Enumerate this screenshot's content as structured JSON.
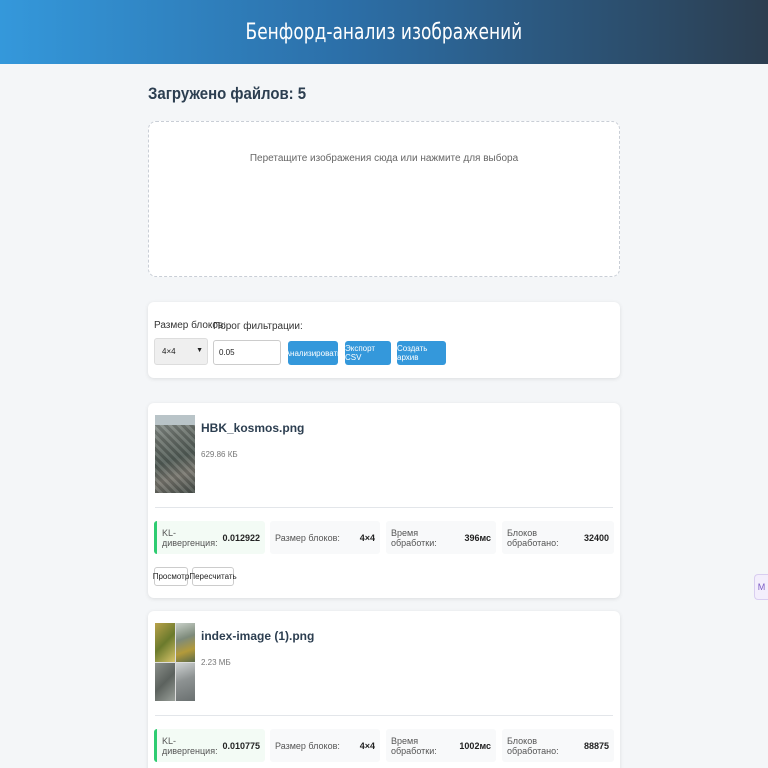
{
  "header": {
    "title": "Бенфорд-анализ изображений"
  },
  "upload": {
    "files_count_text": "Загружено файлов: 5",
    "dropzone_hint": "Перетащите изображения сюда или нажмите для выбора"
  },
  "controls": {
    "block_size_label": "Размер блоков:",
    "block_size_value": "4×4",
    "threshold_label": "Порог фильтрации:",
    "threshold_value": "0.05",
    "analyze_label": "Анализировать",
    "export_label": "Экспорт CSV",
    "archive_label": "Создать архив"
  },
  "results": [
    {
      "filename": "HBK_kosmos.png",
      "size": "629.86 КБ",
      "kl_label": "KL-дивергенция:",
      "kl_value": "0.012922",
      "block_label": "Размер блоков:",
      "block_value": "4×4",
      "time_label": "Время обработки:",
      "time_value": "396мс",
      "blocks_label": "Блоков обработано:",
      "blocks_value": "32400",
      "view_label": "Просмотр",
      "recalc_label": "Пересчитать"
    },
    {
      "filename": "index-image (1).png",
      "size": "2.23 МБ",
      "kl_label": "KL-дивергенция:",
      "kl_value": "0.010775",
      "block_label": "Размер блоков:",
      "block_value": "4×4",
      "time_label": "Время обработки:",
      "time_value": "1002мс",
      "blocks_label": "Блоков обработано:",
      "blocks_value": "88875"
    }
  ],
  "side_tab": {
    "label": "M"
  },
  "colors": {
    "accent": "#3498db",
    "header_dark": "#2c3e50",
    "kl_border": "#2ecc71"
  }
}
